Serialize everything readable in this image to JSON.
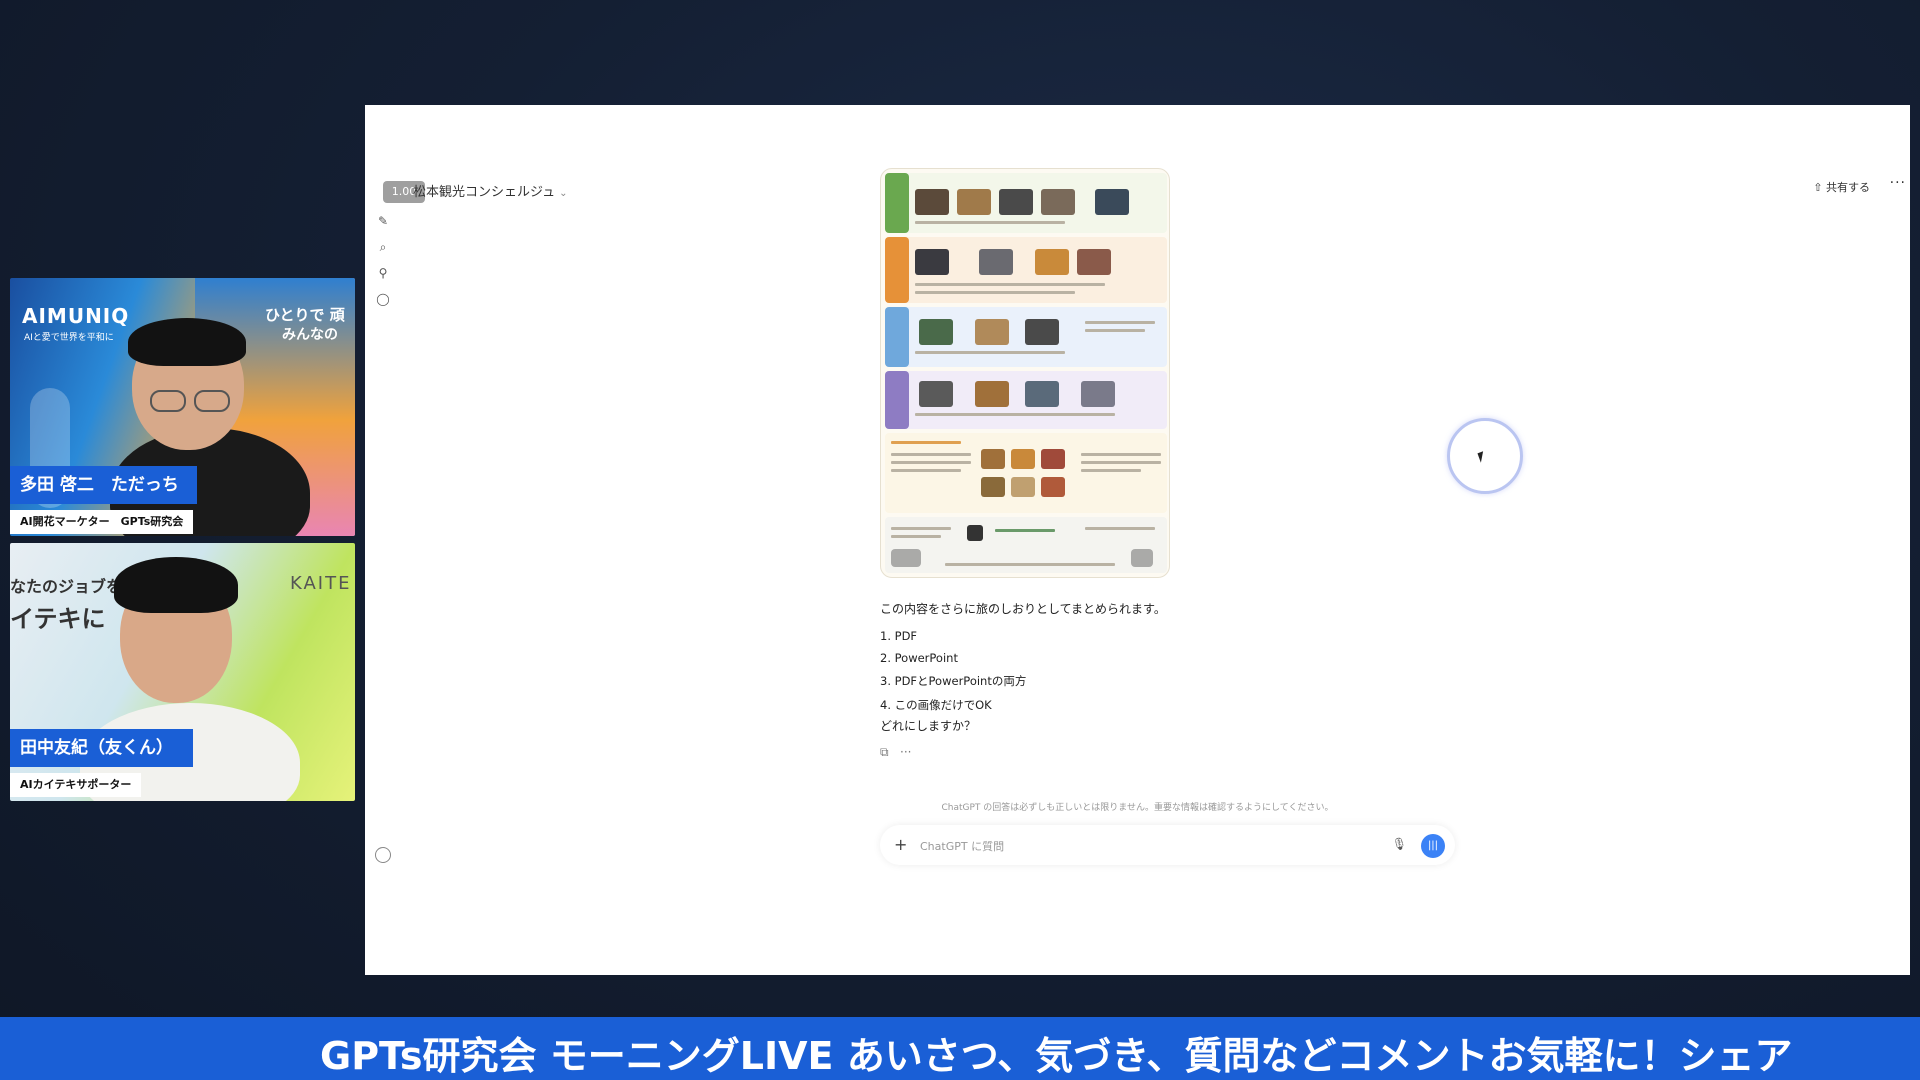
{
  "chat": {
    "title": "松本観光コンシェルジュ",
    "zoom": "1.00",
    "share_label": "共有する",
    "message_intro": "この内容をさらに旅のしおりとしてまとめられます。",
    "options": [
      "1. PDF",
      "2. PowerPoint",
      "3. PDFとPowerPointの両方",
      "4. この画像だけでOK"
    ],
    "question": "どれにしますか？",
    "disclaimer": "ChatGPT の回答は必ずしも正しいとは限りません。重要な情報は確認するようにしてください。",
    "input_placeholder": "ChatGPT に質問"
  },
  "cam1": {
    "brand": "AIMUNIQ",
    "brand_sub": "AIと愛で世界を平和に",
    "tagline": "ひとりで 頑",
    "tagline2": "みんなの",
    "name": "多田 啓二　ただっち",
    "role": "AI開花マーケター　GPTs研究会"
  },
  "cam2": {
    "bg_text1": "なたのジョブを",
    "bg_text2": "イテキに",
    "bg_brand": "KAITE",
    "name": "田中友紀（友くん）",
    "role": "AIカイテキサポーター"
  },
  "ticker": {
    "text": "GPTs研究会 モーニングLIVE あいさつ、気づき、質問などコメントお気軽に！シェア"
  },
  "colors": {
    "accent": "#1a5fd6",
    "send_button": "#3b82f6"
  }
}
